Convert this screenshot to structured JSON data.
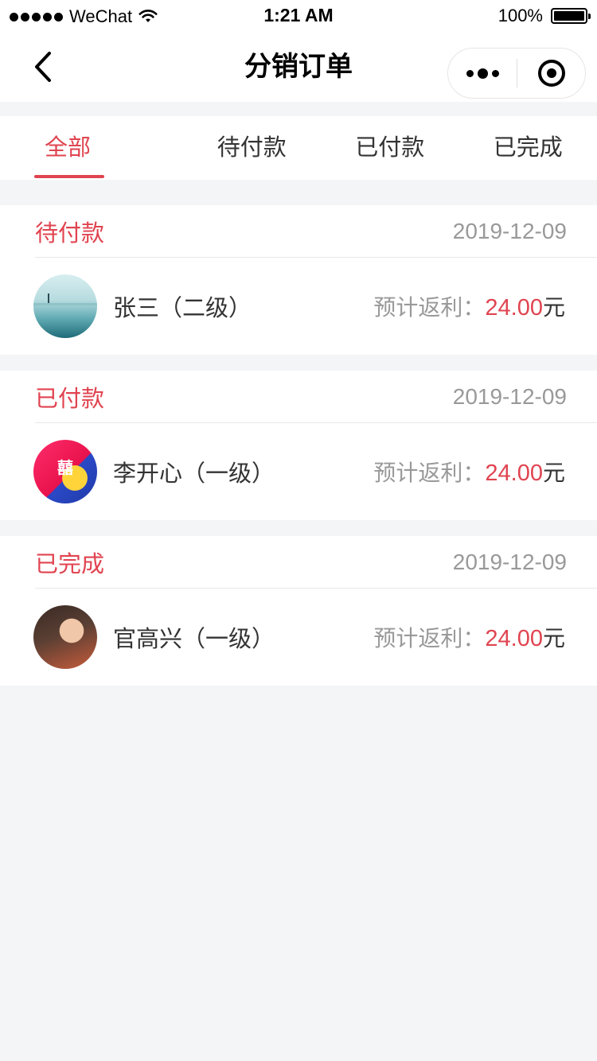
{
  "statusbar": {
    "carrier": "WeChat",
    "time": "1:21 AM",
    "battery": "100%"
  },
  "navbar": {
    "title": "分销订单"
  },
  "tabs": [
    {
      "label": "全部",
      "active": true
    },
    {
      "label": "待付款",
      "active": false
    },
    {
      "label": "已付款",
      "active": false
    },
    {
      "label": "已完成",
      "active": false
    }
  ],
  "orders": [
    {
      "status": "待付款",
      "date": "2019-12-09",
      "name": "张三（二级）",
      "rebate_label": "预计返利：",
      "amount": "24.00",
      "unit": "元",
      "avatar": "avatar-landscape"
    },
    {
      "status": "已付款",
      "date": "2019-12-09",
      "name": "李开心（一级）",
      "rebate_label": "预计返利：",
      "amount": "24.00",
      "unit": "元",
      "avatar": "avatar-cartoon",
      "avatar_mark": "囍"
    },
    {
      "status": "已完成",
      "date": "2019-12-09",
      "name": "官高兴（一级）",
      "rebate_label": "预计返利：",
      "amount": "24.00",
      "unit": "元",
      "avatar": "avatar-portrait"
    }
  ],
  "colors": {
    "accent": "#e04450",
    "muted": "#999999",
    "background": "#f4f5f7"
  }
}
